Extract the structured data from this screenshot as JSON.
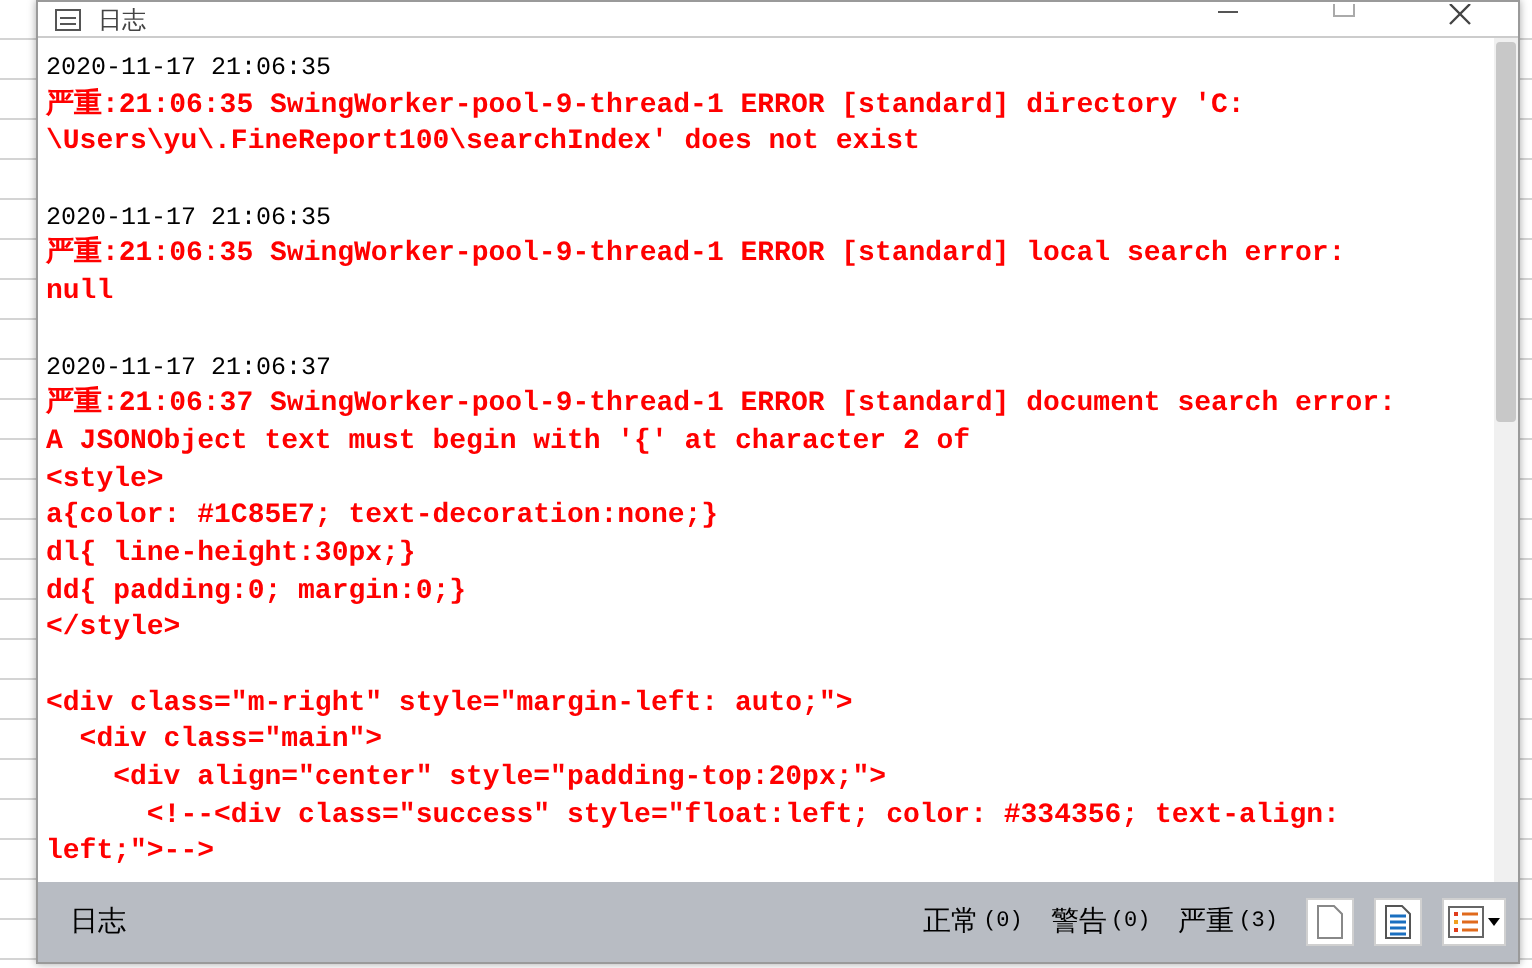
{
  "window": {
    "title": "日志"
  },
  "log": [
    {
      "timestamp": "2020-11-17 21:06:35",
      "paragraphs": [
        [
          "严重:21:06:35 SwingWorker-pool-9-thread-1 ERROR [standard] directory 'C:",
          "\\Users\\yu\\.FineReport100\\searchIndex' does not exist"
        ]
      ]
    },
    {
      "timestamp": "2020-11-17 21:06:35",
      "paragraphs": [
        [
          "严重:21:06:35 SwingWorker-pool-9-thread-1 ERROR [standard] local search error:",
          "null"
        ]
      ]
    },
    {
      "timestamp": "2020-11-17 21:06:37",
      "paragraphs": [
        [
          "严重:21:06:37 SwingWorker-pool-9-thread-1 ERROR [standard] document search error:",
          "A JSONObject text must begin with '{' at character 2 of",
          "<style>",
          "a{color: #1C85E7; text-decoration:none;}",
          "dl{ line-height:30px;}",
          "dd{ padding:0; margin:0;}",
          "</style>"
        ],
        [
          "<div class=\"m-right\" style=\"margin-left: auto;\">",
          "  <div class=\"main\">",
          "    <div align=\"center\" style=\"padding-top:20px;\">",
          "      <!--<div class=\"success\" style=\"float:left; color: #334356; text-align:",
          "left;\">-->"
        ]
      ]
    }
  ],
  "status_bar": {
    "label": "日志",
    "counts": [
      {
        "label": "正常",
        "count": "(0)"
      },
      {
        "label": "警告",
        "count": "(0)"
      },
      {
        "label": "严重",
        "count": "(3)"
      }
    ]
  }
}
